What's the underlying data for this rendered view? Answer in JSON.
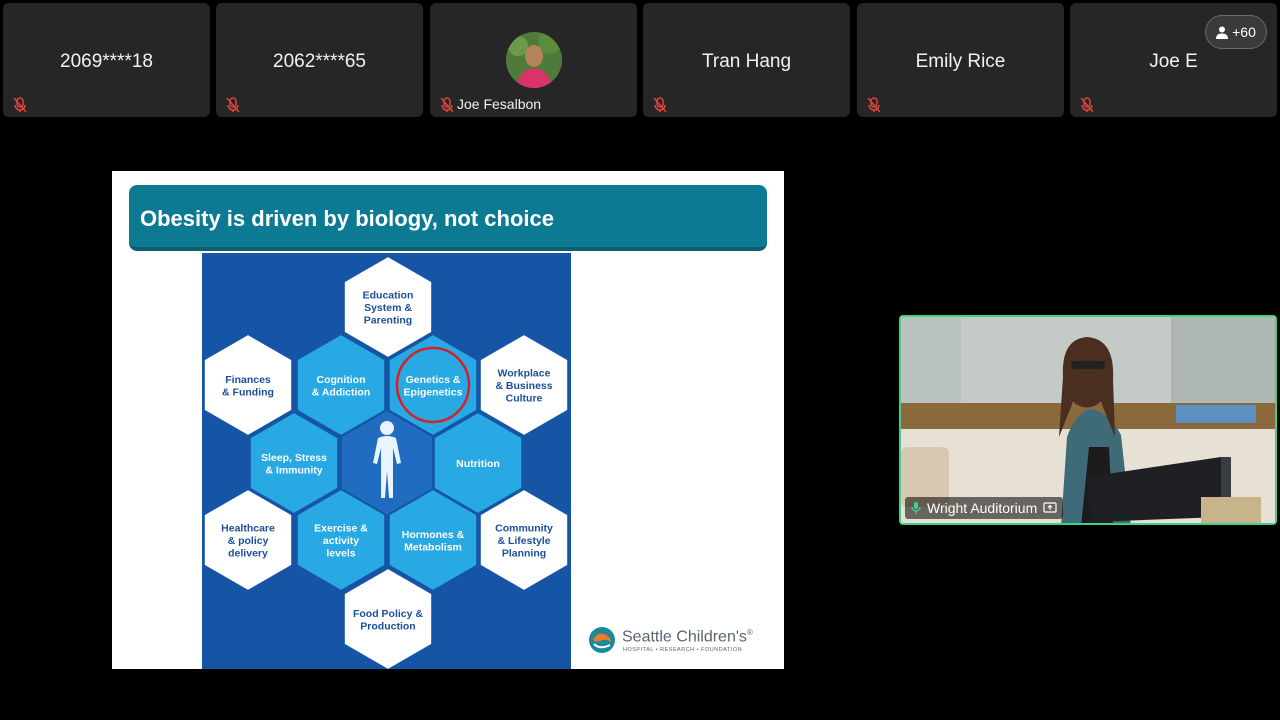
{
  "participants": [
    {
      "name": "2069****18",
      "mic": "muted"
    },
    {
      "name": "2062****65",
      "mic": "muted"
    },
    {
      "name": "Joe Fesalbon",
      "mic": "muted",
      "has_avatar": true
    },
    {
      "name": "Tran Hang",
      "mic": "muted"
    },
    {
      "name": "Emily Rice",
      "mic": "muted"
    },
    {
      "name": "Joe E",
      "mic": "muted"
    }
  ],
  "more_participants": "+60",
  "slide": {
    "title": "Obesity is driven by biology, not choice",
    "hexagons": [
      {
        "id": "education",
        "label": [
          "Education",
          "System &",
          "Parenting"
        ],
        "style": "white"
      },
      {
        "id": "finances",
        "label": [
          "Finances",
          "& Funding"
        ],
        "style": "white"
      },
      {
        "id": "cognition",
        "label": [
          "Cognition",
          "& Addiction"
        ],
        "style": "blue"
      },
      {
        "id": "genetics",
        "label": [
          "Genetics &",
          "Epigenetics"
        ],
        "style": "blue",
        "circled": true
      },
      {
        "id": "workplace",
        "label": [
          "Workplace",
          "& Business",
          "Culture"
        ],
        "style": "white"
      },
      {
        "id": "sleep",
        "label": [
          "Sleep, Stress",
          "& Immunity"
        ],
        "style": "blue"
      },
      {
        "id": "nutrition",
        "label": [
          "Nutrition"
        ],
        "style": "blue"
      },
      {
        "id": "healthcare",
        "label": [
          "Healthcare",
          "& policy",
          "delivery"
        ],
        "style": "white"
      },
      {
        "id": "exercise",
        "label": [
          "Exercise &",
          "activity",
          "levels"
        ],
        "style": "blue"
      },
      {
        "id": "hormones",
        "label": [
          "Hormones &",
          "Metabolism"
        ],
        "style": "blue"
      },
      {
        "id": "community",
        "label": [
          "Community",
          "& Lifestyle",
          "Planning"
        ],
        "style": "white"
      },
      {
        "id": "food",
        "label": [
          "Food Policy &",
          "Production"
        ],
        "style": "white"
      }
    ],
    "logo_name": "Seattle Children's",
    "logo_reg": "®",
    "logo_sub": "HOSPITAL • RESEARCH • FOUNDATION"
  },
  "active_speaker": {
    "label": "Wright Auditorium"
  },
  "colors": {
    "slide_header": "#0d7a93",
    "hex_panel": "#1655a6",
    "hex_blue": "#28a9e3",
    "hex_text_dark": "#1b4f9a",
    "speaker_border": "#3fd08a",
    "muted_mic": "#e0443e"
  }
}
